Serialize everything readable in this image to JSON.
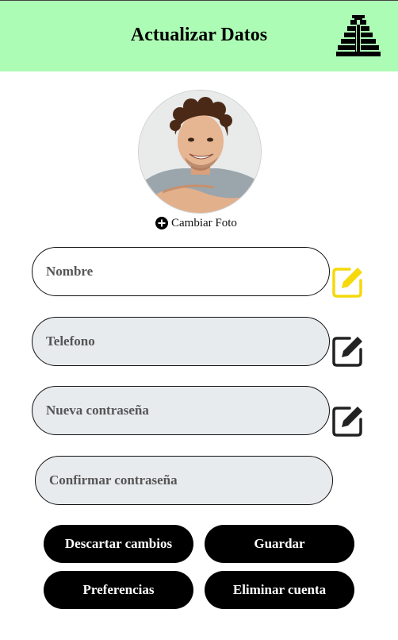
{
  "header": {
    "title": "Actualizar Datos",
    "logo_icon": "pyramid-icon",
    "background_color": "#adfcb5"
  },
  "profile": {
    "avatar_icon": "profile-photo",
    "change_photo_icon": "plus-circle-icon",
    "change_photo_label": "Cambiar Foto"
  },
  "fields": [
    {
      "placeholder": "Nombre",
      "edit_icon": "edit-icon",
      "edit_icon_color": "#f5d90a"
    },
    {
      "placeholder": "Telefono",
      "edit_icon": "edit-icon",
      "edit_icon_color": "#222222"
    },
    {
      "placeholder": "Nueva contraseña",
      "edit_icon": "edit-icon",
      "edit_icon_color": "#222222"
    },
    {
      "placeholder": "Confirmar contraseña"
    }
  ],
  "buttons": {
    "discard": "Descartar cambios",
    "save": "Guardar",
    "preferences": "Preferencias",
    "delete_account": "Eliminar cuenta"
  }
}
